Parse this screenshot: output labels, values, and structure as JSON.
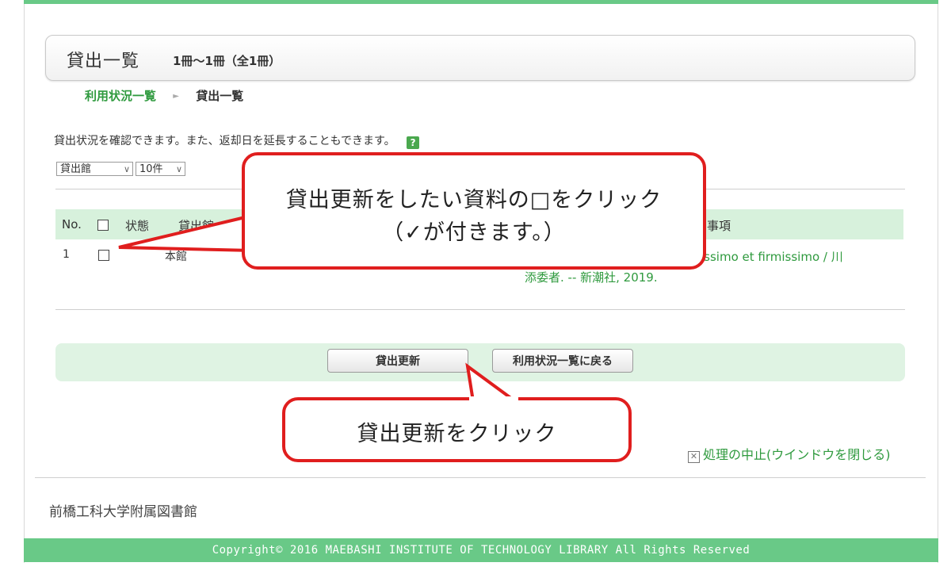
{
  "page": {
    "title": "貸出一覧",
    "count": "1冊～1冊（全1冊）"
  },
  "breadcrumb": {
    "parent": "利用状況一覧",
    "separator": "►",
    "current": "貸出一覧"
  },
  "description": "貸出状況を確認できます。また、返却日を延長することもできます。",
  "help_icon": "?",
  "filters": {
    "library_select": "貸出館",
    "count_select": "10件"
  },
  "table": {
    "headers": {
      "no": "No.",
      "status": "状態",
      "library": "貸出館",
      "notes": "事項"
    },
    "rows": [
      {
        "no": "1",
        "library": "本館",
        "title_line1": "issimo et firmissimo / 川",
        "title_line2": "添委者. -- 新潮社, 2019."
      }
    ]
  },
  "buttons": {
    "renew": "貸出更新",
    "back": "利用状況一覧に戻る"
  },
  "cancel_link": "処理の中止(ウインドウを閉じる)",
  "footer": {
    "library_name": "前橋工科大学附属図書館",
    "copyright": "Copyright© 2016 MAEBASHI INSTITUTE OF TECHNOLOGY LIBRARY All Rights Reserved"
  },
  "callouts": {
    "checkbox_line1": "貸出更新をしたい資料の□をクリック",
    "checkbox_line2": "（✓が付きます。）",
    "renew": "貸出更新をクリック"
  },
  "colors": {
    "accent_green": "#69c987",
    "link_green": "#2f9a3e",
    "header_green": "#d7f1dc",
    "callout_red": "#e01e1e"
  }
}
